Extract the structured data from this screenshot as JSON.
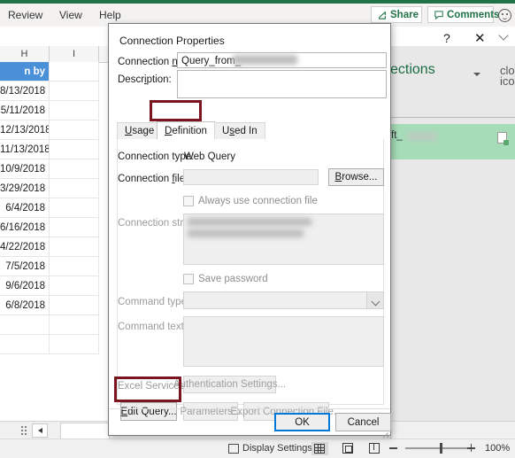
{
  "app": {
    "ribbon_tabs": [
      "Review",
      "View",
      "Help"
    ],
    "share_label": "Share",
    "comments_label": "Comments",
    "share_icon": "share-icon",
    "comments_icon": "comment-icon",
    "smiley_icon": "feedback-smiley-icon"
  },
  "grid": {
    "column_headers": [
      "H",
      "I"
    ],
    "header_cell": "n by",
    "cells": [
      "8/13/2018",
      "5/11/2018",
      "12/13/2018",
      "11/13/2018",
      "10/9/2018",
      "3/29/2018",
      "6/4/2018",
      "6/16/2018",
      "4/22/2018",
      "7/5/2018",
      "9/6/2018",
      "6/8/2018"
    ]
  },
  "queries_pane": {
    "title": "ections",
    "dropdown_icon": "chevron-down-icon",
    "close_icon": "close-icon",
    "item_text": "ft_",
    "item_icon": "query-file-icon"
  },
  "status_bar": {
    "display_settings": "Display Settings",
    "display_settings_icon": "display-settings-icon",
    "view_normal_icon": "normal-view-icon",
    "view_page_layout_icon": "page-layout-view-icon",
    "view_page_break_icon": "page-break-view-icon",
    "zoom_out_icon": "zoom-out-icon",
    "zoom_in_icon": "zoom-in-icon",
    "zoom_percent": "100%"
  },
  "dialog": {
    "title": "Connection Properties",
    "help_icon": "?",
    "close_icon": "✕",
    "connection_name_label": "Connection name:",
    "connection_name_label_pre": "Connection ",
    "connection_name_label_accel": "n",
    "connection_name_label_post": "ame:",
    "connection_name_value": "Query_from_",
    "description_label": "Description:",
    "description_value": "",
    "tabs": [
      {
        "label": "Usage",
        "accel": "U",
        "active": false
      },
      {
        "label": "Definition",
        "accel": "D",
        "active": true
      },
      {
        "label": "Used In",
        "accel": "s",
        "active": false
      }
    ],
    "connection_type_label": "Connection type:",
    "connection_type_value": "Web Query",
    "connection_file_label": "Connection file:",
    "connection_file_label_pre": "Connection ",
    "connection_file_label_accel": "f",
    "connection_file_label_post": "ile:",
    "connection_file_value": "",
    "browse_button": "Browse...",
    "browse_accel": "B",
    "always_use_label": "Always use connection file",
    "always_use_checked": false,
    "connection_string_label": "Connection string:",
    "connection_string_value": "",
    "save_password_label": "Save password",
    "save_password_checked": false,
    "command_type_label": "Command type:",
    "command_type_value": "",
    "command_type_arrow_icon": "chevron-down-icon",
    "command_text_label": "Command text:",
    "command_text_value": "",
    "excel_services_label": "Excel Services:",
    "auth_settings_button": "Authentication Settings...",
    "edit_query_button": "Edit Query...",
    "edit_query_accel": "E",
    "parameters_button": "Parameters...",
    "export_connection_button": "Export Connection File...",
    "ok_button": "OK",
    "cancel_button": "Cancel"
  },
  "annotations": {
    "color": "#7a1520",
    "boxes": [
      "definition-tab-highlight",
      "edit-query-highlight"
    ]
  }
}
